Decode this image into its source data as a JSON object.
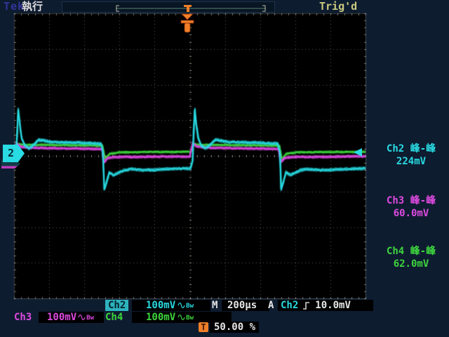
{
  "header": {
    "logo": "Tek",
    "acq_status": "執行",
    "trig_status": "Trig'd"
  },
  "colors": {
    "ch2": "#29dbe3",
    "ch3": "#dd4ae0",
    "ch4": "#3ed43e",
    "trigger_orange": "#ef7f28",
    "status_tan": "#c9c97f",
    "background": "#0e1c30"
  },
  "markers": {
    "ch2_ref": "2",
    "trigger_icon": "T"
  },
  "measurements": [
    {
      "channel": "Ch2",
      "label": "Ch2 峰-峰",
      "value": "224mV"
    },
    {
      "channel": "Ch3",
      "label": "Ch3 峰-峰",
      "value": "60.0mV"
    },
    {
      "channel": "Ch4",
      "label": "Ch4 峰-峰",
      "value": "62.0mV"
    }
  ],
  "readouts": {
    "ch2_label": "Ch2",
    "ch2_scale": "100mV",
    "ch3_label": "Ch3",
    "ch3_scale": "100mV",
    "ch4_label": "Ch4",
    "ch4_scale": "100mV",
    "bw_label": "Bw",
    "timebase_label": "M",
    "timebase": "200µs",
    "trig_mode": "A",
    "trig_source": "Ch2",
    "trig_level": "10.0mV",
    "trig_pos_icon": "T",
    "trig_pos": "50.00 %"
  },
  "chart_data": {
    "type": "line",
    "title": "Oscilloscope traces",
    "x_unit": "divisions",
    "time_per_div": "200µs",
    "x_range": [
      0,
      10
    ],
    "y_unit": "mV relative to Ch2 reference",
    "volts_per_div_mV": 100,
    "grid": {
      "h_divisions": 10,
      "v_divisions": 8,
      "style": "dotted"
    },
    "legend_position": "right-margin",
    "series": [
      {
        "name": "Ch2",
        "color": "#29dbe3",
        "volts_per_div": "100mV",
        "peak_to_peak": "224mV",
        "points": [
          [
            0,
            -10
          ],
          [
            0.05,
            -8
          ],
          [
            0.09,
            60
          ],
          [
            0.12,
            124
          ],
          [
            0.16,
            86
          ],
          [
            0.22,
            44
          ],
          [
            0.3,
            24
          ],
          [
            0.42,
            15
          ],
          [
            0.55,
            24
          ],
          [
            0.7,
            39
          ],
          [
            0.85,
            37
          ],
          [
            1.05,
            33
          ],
          [
            1.4,
            32
          ],
          [
            1.9,
            31
          ],
          [
            2.3,
            29
          ],
          [
            2.48,
            28
          ],
          [
            2.53,
            6
          ],
          [
            2.57,
            -100
          ],
          [
            2.63,
            -80
          ],
          [
            2.71,
            -52
          ],
          [
            2.83,
            -60
          ],
          [
            2.97,
            -53
          ],
          [
            3.12,
            -46
          ],
          [
            3.35,
            -43
          ],
          [
            3.65,
            -46
          ],
          [
            4.0,
            -45
          ],
          [
            4.4,
            -43
          ],
          [
            4.8,
            -42
          ],
          [
            5.02,
            -41
          ],
          [
            5.08,
            -20
          ],
          [
            5.11,
            60
          ],
          [
            5.14,
            124
          ],
          [
            5.18,
            86
          ],
          [
            5.24,
            44
          ],
          [
            5.32,
            24
          ],
          [
            5.44,
            15
          ],
          [
            5.57,
            24
          ],
          [
            5.72,
            39
          ],
          [
            5.87,
            37
          ],
          [
            6.07,
            33
          ],
          [
            6.42,
            32
          ],
          [
            6.92,
            31
          ],
          [
            7.32,
            29
          ],
          [
            7.5,
            28
          ],
          [
            7.56,
            6
          ],
          [
            7.6,
            -100
          ],
          [
            7.66,
            -80
          ],
          [
            7.74,
            -52
          ],
          [
            7.86,
            -60
          ],
          [
            8.0,
            -53
          ],
          [
            8.15,
            -46
          ],
          [
            8.38,
            -43
          ],
          [
            8.68,
            -46
          ],
          [
            9.05,
            -45
          ],
          [
            9.45,
            -43
          ],
          [
            10,
            -41
          ]
        ]
      },
      {
        "name": "Ch3",
        "color": "#dd4ae0",
        "volts_per_div": "100mV",
        "peak_to_peak": "60.0mV",
        "points": [
          [
            0,
            12
          ],
          [
            0.07,
            30
          ],
          [
            0.18,
            20
          ],
          [
            0.4,
            17
          ],
          [
            0.9,
            16
          ],
          [
            1.6,
            15
          ],
          [
            2.2,
            14
          ],
          [
            2.5,
            13
          ],
          [
            2.56,
            -24
          ],
          [
            2.66,
            -12
          ],
          [
            2.9,
            -9
          ],
          [
            3.5,
            -9
          ],
          [
            4.2,
            -8
          ],
          [
            5.0,
            -8
          ],
          [
            5.09,
            30
          ],
          [
            5.2,
            20
          ],
          [
            5.45,
            17
          ],
          [
            5.95,
            16
          ],
          [
            6.6,
            15
          ],
          [
            7.2,
            14
          ],
          [
            7.52,
            13
          ],
          [
            7.59,
            -24
          ],
          [
            7.69,
            -12
          ],
          [
            7.95,
            -9
          ],
          [
            8.6,
            -9
          ],
          [
            9.3,
            -8
          ],
          [
            10,
            -7
          ]
        ]
      },
      {
        "name": "Ch4",
        "color": "#3ed43e",
        "volts_per_div": "100mV",
        "peak_to_peak": "62.0mV",
        "points": [
          [
            0,
            20
          ],
          [
            0.1,
            28
          ],
          [
            0.25,
            25
          ],
          [
            0.7,
            25
          ],
          [
            1.5,
            24
          ],
          [
            2.3,
            23
          ],
          [
            2.52,
            22
          ],
          [
            2.59,
            -14
          ],
          [
            2.72,
            0
          ],
          [
            3.0,
            4
          ],
          [
            3.8,
            5
          ],
          [
            4.6,
            5
          ],
          [
            5.04,
            6
          ],
          [
            5.12,
            28
          ],
          [
            5.28,
            25
          ],
          [
            5.75,
            25
          ],
          [
            6.5,
            24
          ],
          [
            7.3,
            23
          ],
          [
            7.55,
            22
          ],
          [
            7.62,
            -14
          ],
          [
            7.75,
            0
          ],
          [
            8.05,
            4
          ],
          [
            8.8,
            5
          ],
          [
            9.6,
            5
          ],
          [
            10,
            6
          ]
        ]
      }
    ]
  }
}
